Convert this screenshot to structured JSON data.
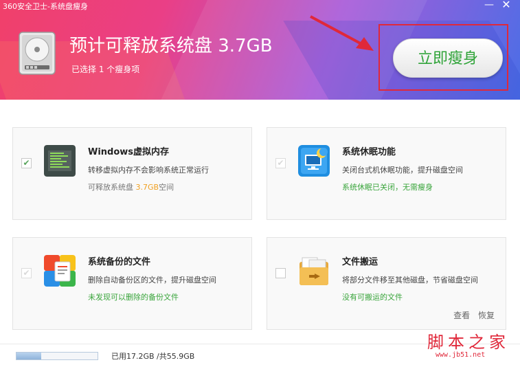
{
  "window": {
    "title": "360安全卫士-系统盘瘦身",
    "minimize": "—",
    "close": "✕"
  },
  "header": {
    "headline": "预计可释放系统盘 3.7GB",
    "subline": "已选择 1 个瘦身项",
    "action_label": "立即瘦身",
    "colors": {
      "accent": "#e0283a",
      "button_text": "#2fa338"
    }
  },
  "cards": [
    {
      "title": "Windows虚拟内存",
      "desc": "转移虚拟内存不会影响系统正常运行",
      "status_prefix": "可释放系统盘 ",
      "status_value": "3.7GB",
      "status_suffix": "空间",
      "checked": true,
      "icon": "memory-icon"
    },
    {
      "title": "系统休眠功能",
      "desc": "关闭台式机休眠功能，提升磁盘空间",
      "status": "系统休眠已关闭，无需瘦身",
      "checked": true,
      "disabled": true,
      "icon": "hibernate-icon"
    },
    {
      "title": "系统备份的文件",
      "desc": "删除自动备份区的文件，提升磁盘空间",
      "status": "未发现可以删除的备份文件",
      "checked": true,
      "disabled": true,
      "icon": "backup-files-icon"
    },
    {
      "title": "文件搬运",
      "desc": "将部分文件移至其他磁盘，节省磁盘空间",
      "status": "没有可搬运的文件",
      "checked": false,
      "icon": "file-move-icon",
      "links": [
        "查看",
        "恢复"
      ]
    }
  ],
  "footer": {
    "usage_text": "已用17.2GB /共55.9GB",
    "usage_fraction": 0.308
  },
  "watermark": {
    "big": "脚本之家",
    "small": "www.jb51.net"
  }
}
